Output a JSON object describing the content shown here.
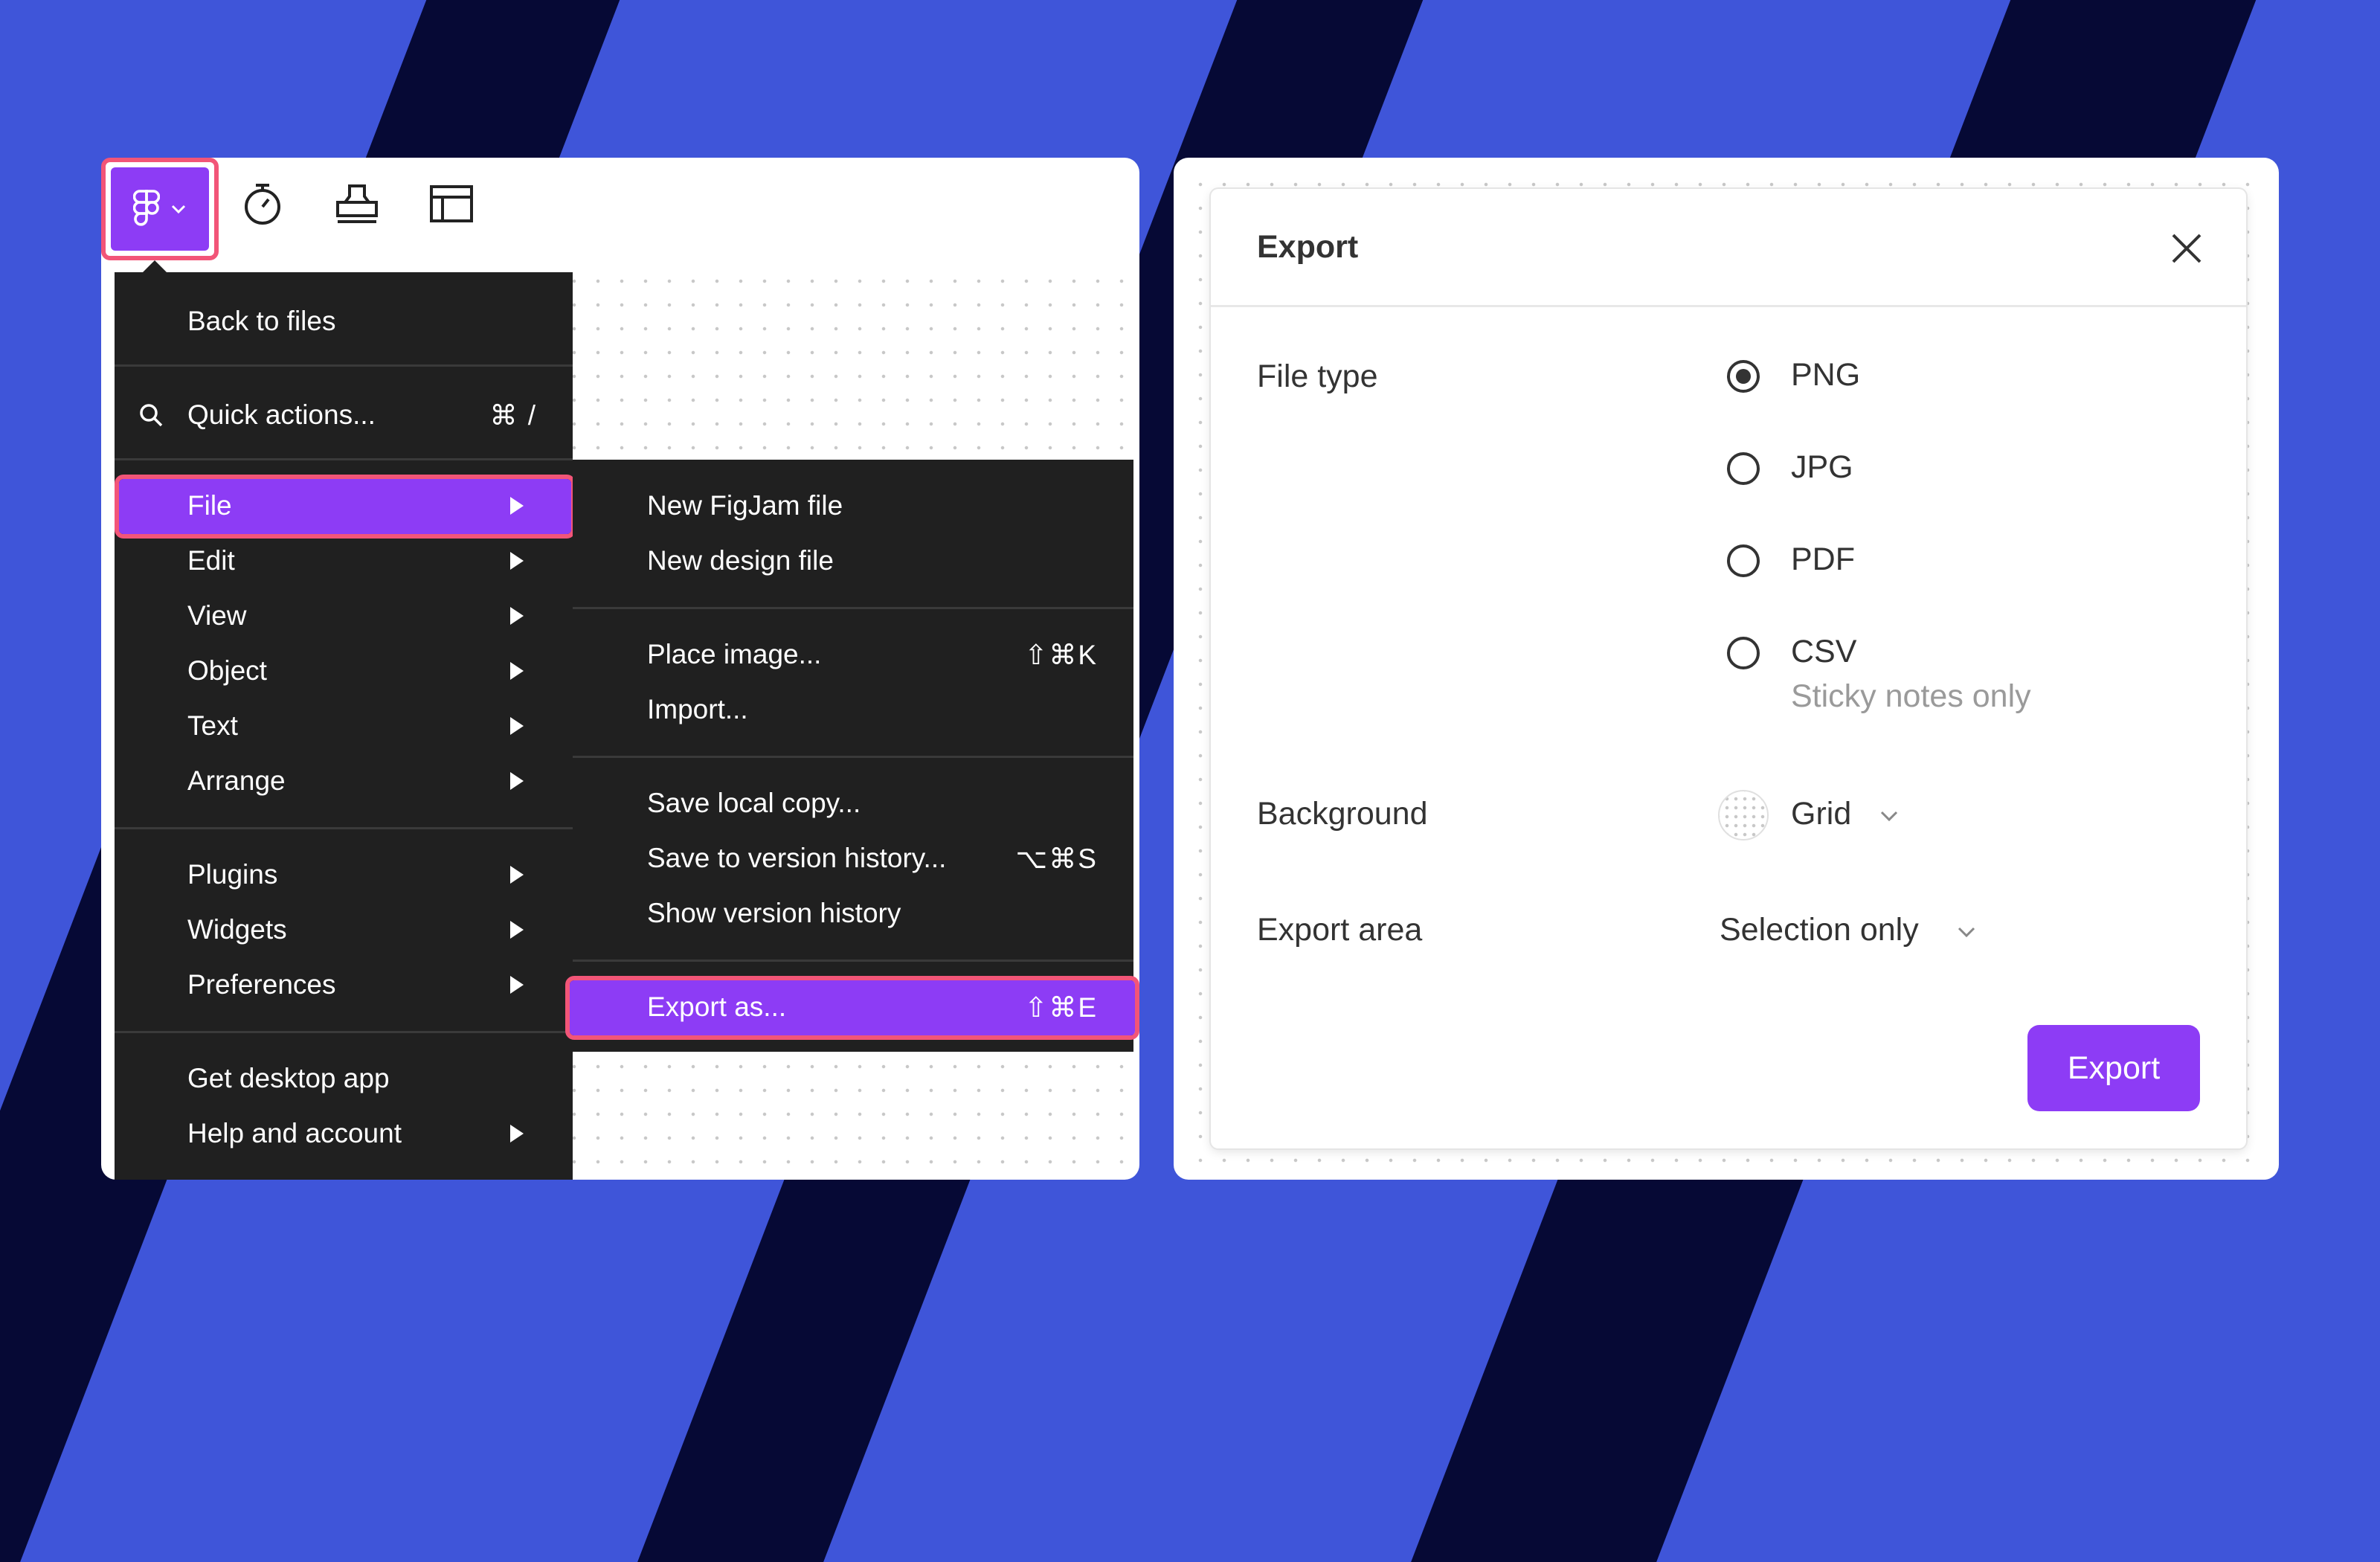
{
  "colors": {
    "background": "#3f55d9",
    "stripes": "#060935",
    "menu_bg": "#202020",
    "accent": "#8d3cf5",
    "highlight_border": "#f25578"
  },
  "toolbar": {
    "icons": [
      "figma-logo-icon",
      "chevron-down-icon",
      "timer-icon",
      "stamp-icon",
      "table-icon"
    ]
  },
  "main_menu": {
    "back_to_files": "Back to files",
    "quick_actions": {
      "label": "Quick actions...",
      "shortcut": "⌘ /"
    },
    "items": [
      {
        "label": "File"
      },
      {
        "label": "Edit"
      },
      {
        "label": "View"
      },
      {
        "label": "Object"
      },
      {
        "label": "Text"
      },
      {
        "label": "Arrange"
      },
      {
        "label": "Plugins"
      },
      {
        "label": "Widgets"
      },
      {
        "label": "Preferences"
      },
      {
        "label": "Get desktop app"
      },
      {
        "label": "Help and account"
      }
    ]
  },
  "file_submenu": {
    "items": [
      {
        "label": "New FigJam file",
        "shortcut": ""
      },
      {
        "label": "New design file",
        "shortcut": ""
      },
      {
        "label": "Place image...",
        "shortcut": "⇧⌘K"
      },
      {
        "label": "Import...",
        "shortcut": ""
      },
      {
        "label": "Save local copy...",
        "shortcut": ""
      },
      {
        "label": "Save to version history...",
        "shortcut": "⌥⌘S"
      },
      {
        "label": "Show version history",
        "shortcut": ""
      },
      {
        "label": "Export as...",
        "shortcut": "⇧⌘E"
      }
    ]
  },
  "export_dialog": {
    "title": "Export",
    "file_type_label": "File type",
    "file_types": [
      {
        "label": "PNG",
        "selected": true
      },
      {
        "label": "JPG",
        "selected": false
      },
      {
        "label": "PDF",
        "selected": false
      },
      {
        "label": "CSV",
        "selected": false
      }
    ],
    "csv_note": "Sticky notes only",
    "background_label": "Background",
    "background_value": "Grid",
    "export_area_label": "Export area",
    "export_area_value": "Selection only",
    "export_button": "Export"
  }
}
